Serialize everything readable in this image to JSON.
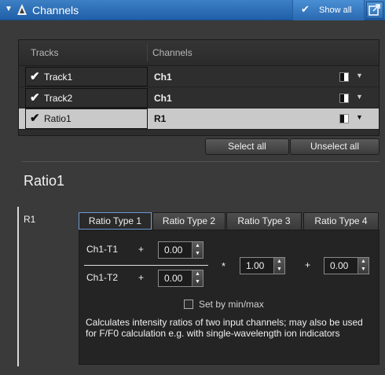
{
  "titlebar": {
    "title": "Channels",
    "show_all_label": "Show all",
    "arrow_icon": "triangle-down-icon",
    "app_icon": "channels-icon",
    "expand_icon": "expand-icon",
    "accent": "#2d6fb8"
  },
  "table": {
    "headers": [
      "Tracks",
      "Channels"
    ],
    "rows": [
      {
        "track": "Track1",
        "channel": "Ch1",
        "checked": true,
        "selected": false
      },
      {
        "track": "Track2",
        "channel": "Ch1",
        "checked": true,
        "selected": false
      },
      {
        "track": "Ratio1",
        "channel": "R1",
        "checked": true,
        "selected": true
      }
    ]
  },
  "buttons": {
    "select_all": "Select all",
    "unselect_all": "Unselect all"
  },
  "section": {
    "title": "Ratio1",
    "channel_label": "R1"
  },
  "tabs": [
    "Ratio Type 1",
    "Ratio Type 2",
    "Ratio Type 3",
    "Ratio Type 4"
  ],
  "active_tab": "Ratio Type 1",
  "formula": {
    "numerator_label": "Ch1-T1",
    "denominator_label": "Ch1-T2",
    "plus": "+",
    "times": "*",
    "numerator_offset": "0.00",
    "denominator_offset": "0.00",
    "factor": "1.00",
    "offset": "0.00"
  },
  "set_by_minmax": {
    "label": "Set by min/max",
    "checked": false
  },
  "description": "Calculates intensity ratios of two input channels; may also be used for F/F0 calculation e.g. with single-wavelength ion indicators"
}
